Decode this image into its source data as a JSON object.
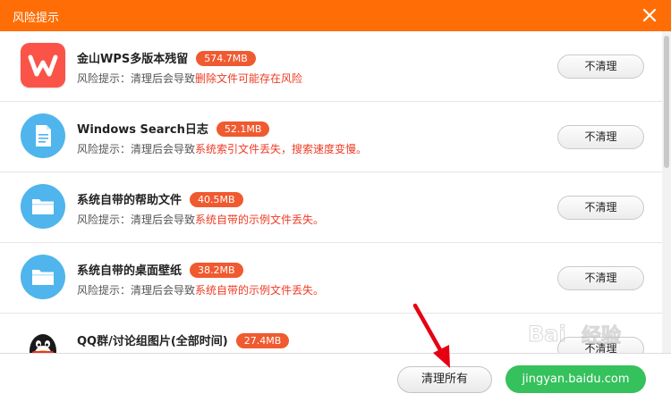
{
  "window": {
    "title": "风险提示"
  },
  "icons": {
    "close": "close-icon",
    "app": "wps-icon",
    "document": "document-icon",
    "folder": "folder-icon",
    "qq": "qq-penguin-icon"
  },
  "colors": {
    "titlebar": "#ff6e06",
    "size_badge": "#f05a30",
    "risk_text": "#ef3b24",
    "primary_button": "#35c15c",
    "folder_icon": "#4fb5ec",
    "app_icon": "#fb5348"
  },
  "risk_prefix": "风险提示：清理后会导致",
  "items": [
    {
      "name": "金山WPS多版本残留",
      "size": "574.7MB",
      "risk": "删除文件可能存在风险",
      "action": "不清理"
    },
    {
      "name": "Windows Search日志",
      "size": "52.1MB",
      "risk": "系统索引文件丢失，搜索速度变慢。",
      "action": "不清理"
    },
    {
      "name": "系统自带的帮助文件",
      "size": "40.5MB",
      "risk": "系统自带的示例文件丢失。",
      "action": "不清理"
    },
    {
      "name": "系统自带的桌面壁纸",
      "size": "38.2MB",
      "risk": "系统自带的示例文件丢失。",
      "action": "不清理"
    },
    {
      "name": "QQ群/讨论组图片(全部时间)",
      "size": "27.4MB",
      "action": "不清理"
    }
  ],
  "footer": {
    "clean_all": "清理所有",
    "smart_button": "jingyan.baidu.com"
  },
  "watermark": {
    "text": "Bai",
    "text2": "经验"
  }
}
